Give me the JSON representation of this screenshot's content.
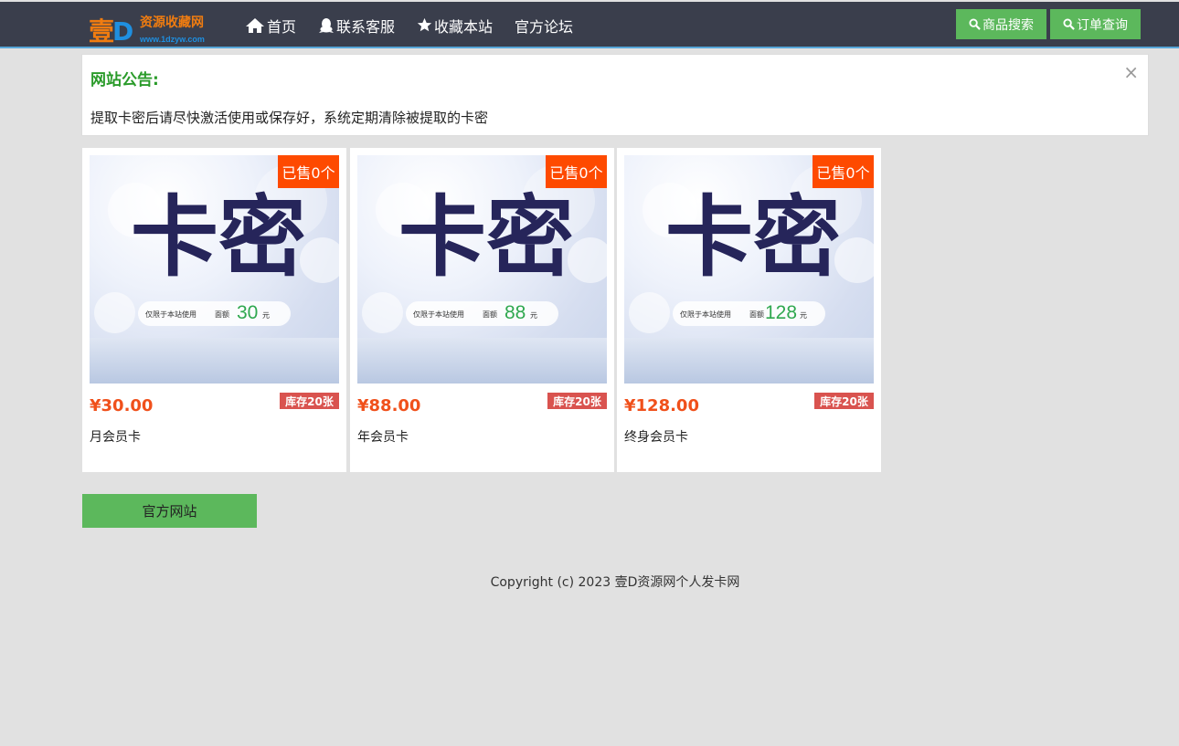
{
  "header": {
    "logo_mark_1": "壹",
    "logo_mark_2": "D",
    "logo_title": "资源收藏网",
    "logo_url": "www.1dzyw.com",
    "nav": [
      {
        "label": "首页",
        "icon": "home-icon"
      },
      {
        "label": "联系客服",
        "icon": "qq-icon"
      },
      {
        "label": "收藏本站",
        "icon": "star-icon"
      },
      {
        "label": "官方论坛",
        "icon": ""
      }
    ],
    "search_button": "商品搜索",
    "order_button": "订单查询"
  },
  "notice": {
    "title": "网站公告:",
    "close": "×",
    "text": "提取卡密后请尽快激活使用或保存好，系统定期清除被提取的卡密"
  },
  "products": [
    {
      "image_title": "卡密",
      "image_note": "仅限于本站使用",
      "image_face_label": "面额",
      "image_value": "30",
      "image_unit": "元",
      "sold": "已售0个",
      "price": "¥30.00",
      "stock": "库存20张",
      "name": "月会员卡"
    },
    {
      "image_title": "卡密",
      "image_note": "仅限于本站使用",
      "image_face_label": "面额",
      "image_value": "88",
      "image_unit": "元",
      "sold": "已售0个",
      "price": "¥88.00",
      "stock": "库存20张",
      "name": "年会员卡"
    },
    {
      "image_title": "卡密",
      "image_note": "仅限于本站使用",
      "image_face_label": "面额",
      "image_value": "128",
      "image_unit": "元",
      "sold": "已售0个",
      "price": "¥128.00",
      "stock": "库存20张",
      "name": "终身会员卡"
    }
  ],
  "official_button": "官方网站",
  "footer": {
    "copyright": "Copyright (c) 2023 壹D资源网个人发卡网"
  },
  "colors": {
    "nav_bg": "#3a3e4c",
    "accent_green": "#5cb85c",
    "notice_title": "#2a9b2a",
    "sold_badge": "#fe4a00",
    "price": "#f0501b",
    "stock_badge": "#d9534f"
  }
}
